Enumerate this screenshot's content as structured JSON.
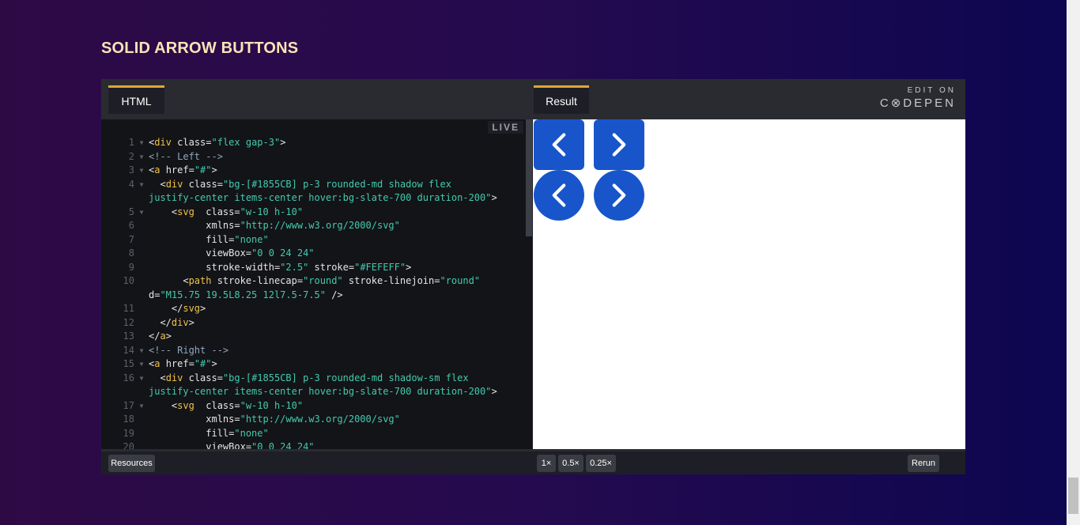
{
  "page": {
    "title": "SOLID ARROW BUTTONS"
  },
  "embed": {
    "tabs": {
      "html": "HTML",
      "result": "Result"
    },
    "codepen": {
      "edit_on": "EDIT ON",
      "brand": "C⊗DEPEN"
    },
    "live_label": "LIVE",
    "code_lines": [
      {
        "n": "1",
        "fold": true,
        "tokens": [
          [
            "t",
            "<"
          ],
          [
            "tag",
            "div"
          ],
          [
            "a",
            " class="
          ],
          [
            "s",
            "\"flex gap-3\""
          ],
          [
            "t",
            ">"
          ]
        ]
      },
      {
        "n": "2",
        "fold": true,
        "tokens": [
          [
            "c",
            "<!-- Left -->"
          ]
        ]
      },
      {
        "n": "3",
        "fold": true,
        "tokens": [
          [
            "t",
            "<"
          ],
          [
            "tag",
            "a"
          ],
          [
            "a",
            " href="
          ],
          [
            "s",
            "\"#\""
          ],
          [
            "t",
            ">"
          ]
        ]
      },
      {
        "n": "4",
        "fold": true,
        "tokens": [
          [
            "t",
            "  <"
          ],
          [
            "tag",
            "div"
          ],
          [
            "a",
            " class="
          ],
          [
            "s",
            "\"bg-[#1855CB] p-3 rounded-md shadow flex"
          ]
        ]
      },
      {
        "n": "",
        "fold": false,
        "tokens": [
          [
            "s",
            "justify-center items-center hover:bg-slate-700 duration-200\""
          ],
          [
            "t",
            ">"
          ]
        ]
      },
      {
        "n": "5",
        "fold": true,
        "tokens": [
          [
            "t",
            "    <"
          ],
          [
            "tag",
            "svg"
          ],
          [
            "a",
            "  class="
          ],
          [
            "s",
            "\"w-10 h-10\""
          ]
        ]
      },
      {
        "n": "6",
        "fold": false,
        "tokens": [
          [
            "a",
            "          xmlns="
          ],
          [
            "s",
            "\"http://www.w3.org/2000/svg\""
          ]
        ]
      },
      {
        "n": "7",
        "fold": false,
        "tokens": [
          [
            "a",
            "          fill="
          ],
          [
            "s",
            "\"none\""
          ]
        ]
      },
      {
        "n": "8",
        "fold": false,
        "tokens": [
          [
            "a",
            "          viewBox="
          ],
          [
            "s",
            "\"0 0 24 24\""
          ]
        ]
      },
      {
        "n": "9",
        "fold": false,
        "tokens": [
          [
            "a",
            "          stroke-width="
          ],
          [
            "s",
            "\"2.5\""
          ],
          [
            "a",
            " stroke="
          ],
          [
            "s",
            "\"#FEFEFF\""
          ],
          [
            "t",
            ">"
          ]
        ]
      },
      {
        "n": "10",
        "fold": false,
        "tokens": [
          [
            "t",
            "      <"
          ],
          [
            "tag",
            "path"
          ],
          [
            "a",
            " stroke-linecap="
          ],
          [
            "s",
            "\"round\""
          ],
          [
            "a",
            " stroke-linejoin="
          ],
          [
            "s",
            "\"round\""
          ]
        ]
      },
      {
        "n": "",
        "fold": false,
        "tokens": [
          [
            "a",
            "d="
          ],
          [
            "s",
            "\"M15.75 19.5L8.25 12l7.5-7.5\""
          ],
          [
            "t",
            " />"
          ]
        ]
      },
      {
        "n": "11",
        "fold": false,
        "tokens": [
          [
            "t",
            "    </"
          ],
          [
            "tag",
            "svg"
          ],
          [
            "t",
            ">"
          ]
        ]
      },
      {
        "n": "12",
        "fold": false,
        "tokens": [
          [
            "t",
            "  </"
          ],
          [
            "tag",
            "div"
          ],
          [
            "t",
            ">"
          ]
        ]
      },
      {
        "n": "13",
        "fold": false,
        "tokens": [
          [
            "t",
            "</"
          ],
          [
            "tag",
            "a"
          ],
          [
            "t",
            ">"
          ]
        ]
      },
      {
        "n": "14",
        "fold": true,
        "tokens": [
          [
            "c",
            "<!-- Right -->"
          ]
        ]
      },
      {
        "n": "15",
        "fold": true,
        "tokens": [
          [
            "t",
            "<"
          ],
          [
            "tag",
            "a"
          ],
          [
            "a",
            " href="
          ],
          [
            "s",
            "\"#\""
          ],
          [
            "t",
            ">"
          ]
        ]
      },
      {
        "n": "16",
        "fold": true,
        "tokens": [
          [
            "t",
            "  <"
          ],
          [
            "tag",
            "div"
          ],
          [
            "a",
            " class="
          ],
          [
            "s",
            "\"bg-[#1855CB] p-3 rounded-md shadow-sm flex"
          ]
        ]
      },
      {
        "n": "",
        "fold": false,
        "tokens": [
          [
            "s",
            "justify-center items-center hover:bg-slate-700 duration-200\""
          ],
          [
            "t",
            ">"
          ]
        ]
      },
      {
        "n": "17",
        "fold": true,
        "tokens": [
          [
            "t",
            "    <"
          ],
          [
            "tag",
            "svg"
          ],
          [
            "a",
            "  class="
          ],
          [
            "s",
            "\"w-10 h-10\""
          ]
        ]
      },
      {
        "n": "18",
        "fold": false,
        "tokens": [
          [
            "a",
            "          xmlns="
          ],
          [
            "s",
            "\"http://www.w3.org/2000/svg\""
          ]
        ]
      },
      {
        "n": "19",
        "fold": false,
        "tokens": [
          [
            "a",
            "          fill="
          ],
          [
            "s",
            "\"none\""
          ]
        ]
      },
      {
        "n": "20",
        "fold": false,
        "tokens": [
          [
            "a",
            "          viewBox="
          ],
          [
            "s",
            "\"0 0 24 24\""
          ]
        ]
      }
    ],
    "bottom": {
      "resources": "Resources",
      "zoom": [
        "1×",
        "0.5×",
        "0.25×"
      ],
      "rerun": "Rerun"
    }
  },
  "colors": {
    "button_blue": "#1855CB",
    "title": "#fde3b6",
    "tab_accent": "#e2a43a"
  },
  "icons": [
    "chevron-left-icon",
    "chevron-right-icon",
    "codepen-icon"
  ]
}
